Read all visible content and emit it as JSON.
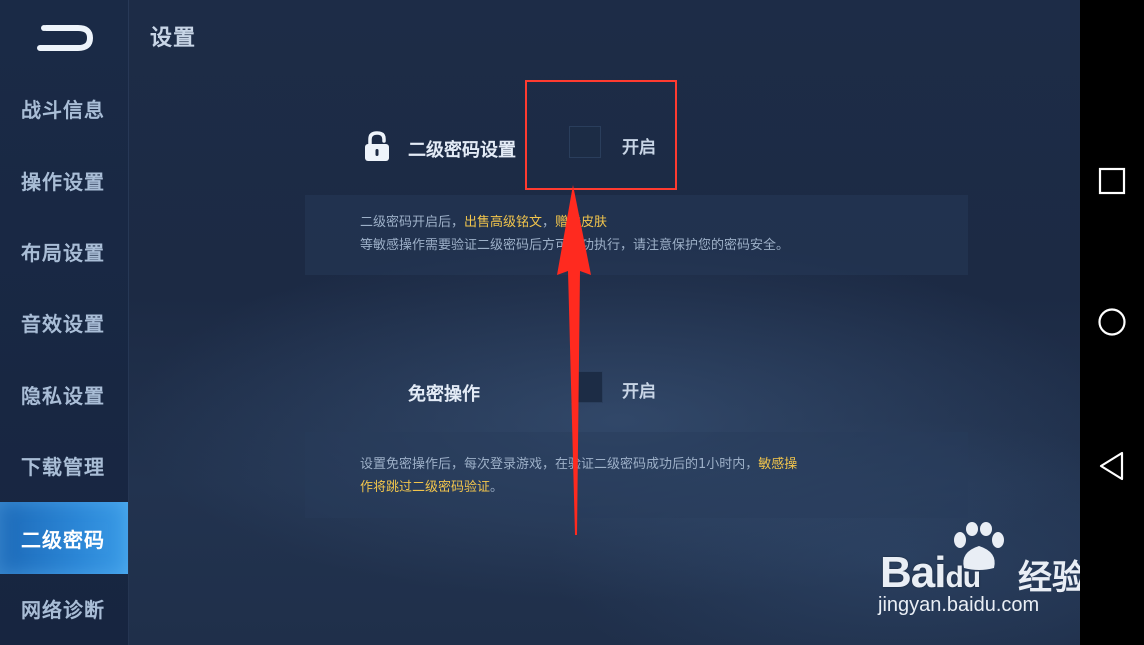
{
  "header": {
    "title": "设置"
  },
  "sidebar": {
    "items": [
      {
        "label": "战斗信息"
      },
      {
        "label": "操作设置"
      },
      {
        "label": "布局设置"
      },
      {
        "label": "音效设置"
      },
      {
        "label": "隐私设置"
      },
      {
        "label": "下载管理"
      },
      {
        "label": "二级密码"
      },
      {
        "label": "网络诊断"
      }
    ],
    "active_index": 6
  },
  "settings": {
    "secondary_password": {
      "label": "二级密码设置",
      "toggle_label": "开启",
      "desc_part1": "二级密码开启后，",
      "desc_hl1": "出售高级铭文",
      "desc_sep": "，",
      "desc_hl2": "赠送皮肤",
      "desc_line2": "等敏感操作需要验证二级密码后方可成功执行，请注意保护您的密码安全。"
    },
    "password_free": {
      "label": "免密操作",
      "toggle_label": "开启",
      "desc_line1a": "设置免密操作后，每次登录游戏，在验证二级密码成功后的1小时内，",
      "desc_hl1": "敏感操",
      "desc_hl2": "作将跳过二级密码验证",
      "desc_end": "。"
    }
  },
  "watermark": {
    "brand": "Bai",
    "brand2": "du",
    "cn": "经验",
    "url": "jingyan.baidu.com"
  },
  "colors": {
    "accent": "#2b86d6",
    "highlight_text": "#f2c54c",
    "annotation": "#ff3b30"
  }
}
